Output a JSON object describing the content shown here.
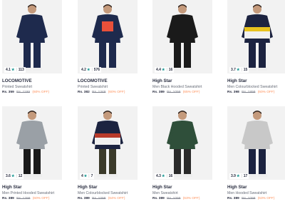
{
  "products": [
    {
      "brand": "LOCOMOTIVE",
      "name": "Printed Sweatshirt",
      "price": "Rs. 359",
      "mrp": "Rs. 1199",
      "discount": "(60% OFF)",
      "rating": "4.1",
      "count": "113",
      "colors": {
        "top": "#1e2a4d",
        "bottom": "#1e2a4d",
        "skin": "#c49a7c"
      }
    },
    {
      "brand": "LOCOMOTIVE",
      "name": "Printed Sweatshirt",
      "price": "Rs. 382",
      "mrp": "Rs. 1349",
      "discount": "(60% OFF)",
      "rating": "4.2",
      "count": "576",
      "colors": {
        "top": "#1e2a4d",
        "bottom": "#1e2a4d",
        "skin": "#c49a7c",
        "print_text": "SAY\n53A",
        "print": "#e8503a"
      }
    },
    {
      "brand": "High Star",
      "name": "Men Black Hooded Sweatshirt",
      "price": "Rs. 389",
      "mrp": "Rs. 1099",
      "discount": "(65% OFF)",
      "rating": "4.4",
      "count": "16",
      "colors": {
        "top": "#1a1a1a",
        "bottom": "#1a1a1a",
        "skin": "#c49a7c"
      }
    },
    {
      "brand": "High Star",
      "name": "Men Colourblocked Sweatshirt",
      "price": "Rs. 398",
      "mrp": "Rs. 1899",
      "discount": "(60% OFF)",
      "rating": "3.7",
      "count": "15",
      "colors": {
        "top": "#1c2340",
        "bottom": "#1c2340",
        "skin": "#c49a7c",
        "stripe": "#e8c21e"
      }
    },
    {
      "brand": "High Star",
      "name": "Men Printed Hooded Sweatshirt",
      "price": "Rs. 389",
      "mrp": "Rs. 1299",
      "discount": "(60% OFF)",
      "rating": "3.6",
      "count": "12",
      "colors": {
        "top": "#9aa0a6",
        "bottom": "#1a1a1a",
        "skin": "#c49a7c"
      }
    },
    {
      "brand": "High Star",
      "name": "Men Colourblocked Sweatshirt",
      "price": "Rs. 389",
      "mrp": "Rs. 1099",
      "discount": "(64% OFF)",
      "rating": "4",
      "count": "7",
      "colors": {
        "top": "#1c2340",
        "bottom": "#3b3a2a",
        "skin": "#c49a7c",
        "stripe": "#b83a2a"
      }
    },
    {
      "brand": "High Star",
      "name": "Men Sweatshirt",
      "price": "Rs. 389",
      "mrp": "Rs. 1099",
      "discount": "(63% OFF)",
      "rating": "4.3",
      "count": "16",
      "colors": {
        "top": "#2f4f3a",
        "bottom": "#2a2a2a",
        "skin": "#c49a7c"
      }
    },
    {
      "brand": "High Star",
      "name": "Men Hooded Sweatshirt",
      "price": "Rs. 389",
      "mrp": "Rs. 1099",
      "discount": "(63% OFF)",
      "rating": "3.9",
      "count": "17",
      "colors": {
        "top": "#c8c8c8",
        "bottom": "#1c2340",
        "skin": "#c49a7c"
      }
    }
  ]
}
